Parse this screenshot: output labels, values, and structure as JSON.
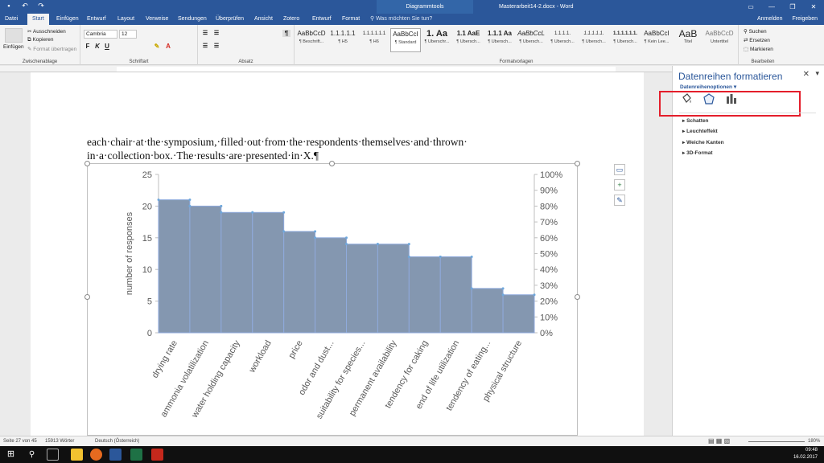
{
  "titlebar": {
    "title": "Masterarbeit14-2.docx - Word",
    "context_tab": "Diagrammtools",
    "keytips": [
      "1",
      "2",
      "3"
    ]
  },
  "tabs": [
    {
      "label": "Datei",
      "key": "D"
    },
    {
      "label": "Start",
      "key": "R"
    },
    {
      "label": "Einfügen",
      "key": "F"
    },
    {
      "label": "Entwurf",
      "key": "A"
    },
    {
      "label": "Layout",
      "key": "S"
    },
    {
      "label": "Verweise",
      "key": "V"
    },
    {
      "label": "Sendungen",
      "key": "G"
    },
    {
      "label": "Überprüfen",
      "key": "P"
    },
    {
      "label": "Ansicht",
      "key": "F"
    },
    {
      "label": "Zotero",
      "key": "Y2"
    },
    {
      "label": "Entwurf",
      "key": "JT"
    },
    {
      "label": "Format",
      "key": "JY"
    }
  ],
  "search_placeholder": "Was möchten Sie tun?",
  "search_key": "M",
  "account": {
    "signin": "Anmelden",
    "share": "Freigeben",
    "share_key": "Y1"
  },
  "clipboard": {
    "paste": "Einfügen",
    "cut": "Ausschneiden",
    "copy": "Kopieren",
    "painter": "Format übertragen",
    "label": "Zwischenablage"
  },
  "font": {
    "name": "Cambria",
    "size": "12",
    "label": "Schriftart"
  },
  "paragraph": {
    "label": "Absatz"
  },
  "styles": {
    "label": "Formatvorlagen",
    "items": [
      {
        "preview": "AaBbCcD",
        "name": "¶ Beschrift..."
      },
      {
        "preview": "1.1.1.1.1",
        "name": "¶ H5"
      },
      {
        "preview": "1.1.1.1.1.1",
        "name": "¶ H6"
      },
      {
        "preview": "AaBbCcI",
        "name": "¶ Standard"
      },
      {
        "preview": "1. Aa",
        "name": "¶ Überschr..."
      },
      {
        "preview": "1.1 AaE",
        "name": "¶ Übersch..."
      },
      {
        "preview": "1.1.1 Aa",
        "name": "¶ Übersch..."
      },
      {
        "preview": "AaBbCcL",
        "name": "¶ Übersch..."
      },
      {
        "preview": "1.1.1.1.",
        "name": "¶ Übersch..."
      },
      {
        "preview": "1.1.1.1.1.",
        "name": "¶ Übersch..."
      },
      {
        "preview": "1.1.1.1.1.1.",
        "name": "¶ Übersch..."
      },
      {
        "preview": "AaBbCcI",
        "name": "¶ Kein Lee..."
      },
      {
        "preview": "AaB",
        "name": "Titel"
      },
      {
        "preview": "AaBbCcD",
        "name": "Untertitel"
      }
    ]
  },
  "editing": {
    "find": "Suchen",
    "replace": "Ersetzen",
    "select": "Markieren",
    "label": "Bearbeiten"
  },
  "document": {
    "line1": "each·chair·at·the·symposium,·filled·out·from·the·respondents·themselves·and·thrown·",
    "line2": "in·a·collection·box.·The·results·are·presented·in·X.¶"
  },
  "chart_data": {
    "type": "bar",
    "categories": [
      "drying rate",
      "ammonia volatilization",
      "water holding capacity",
      "workload",
      "price",
      "odor and dust...",
      "suitability for species...",
      "permanent availability",
      "tendency for caking",
      "end of life utilization",
      "tendency of eating...",
      "physical structure"
    ],
    "values": [
      21,
      20,
      19,
      19,
      16,
      15,
      14,
      14,
      12,
      12,
      7,
      6
    ],
    "ylabel": "number of responses",
    "ylim": [
      0,
      25
    ],
    "yticks": [
      "0",
      "5",
      "10",
      "15",
      "20",
      "25"
    ],
    "y2ticks": [
      "0%",
      "10%",
      "20%",
      "30%",
      "40%",
      "50%",
      "60%",
      "70%",
      "80%",
      "90%",
      "100%"
    ],
    "bar_color": "#8497b0"
  },
  "pane": {
    "title": "Datenreihen formatieren",
    "options": "Datenreihenoptionen",
    "sections": [
      "Schatten",
      "Leuchteffekt",
      "Weiche Kanten",
      "3D-Format"
    ]
  },
  "status": {
    "page": "Seite 27 von 45",
    "words": "15913 Wörter",
    "language": "Deutsch (Österreich)",
    "zoom": "180%"
  },
  "taskbar": {
    "time": "09:48",
    "date": "16.02.2017"
  }
}
